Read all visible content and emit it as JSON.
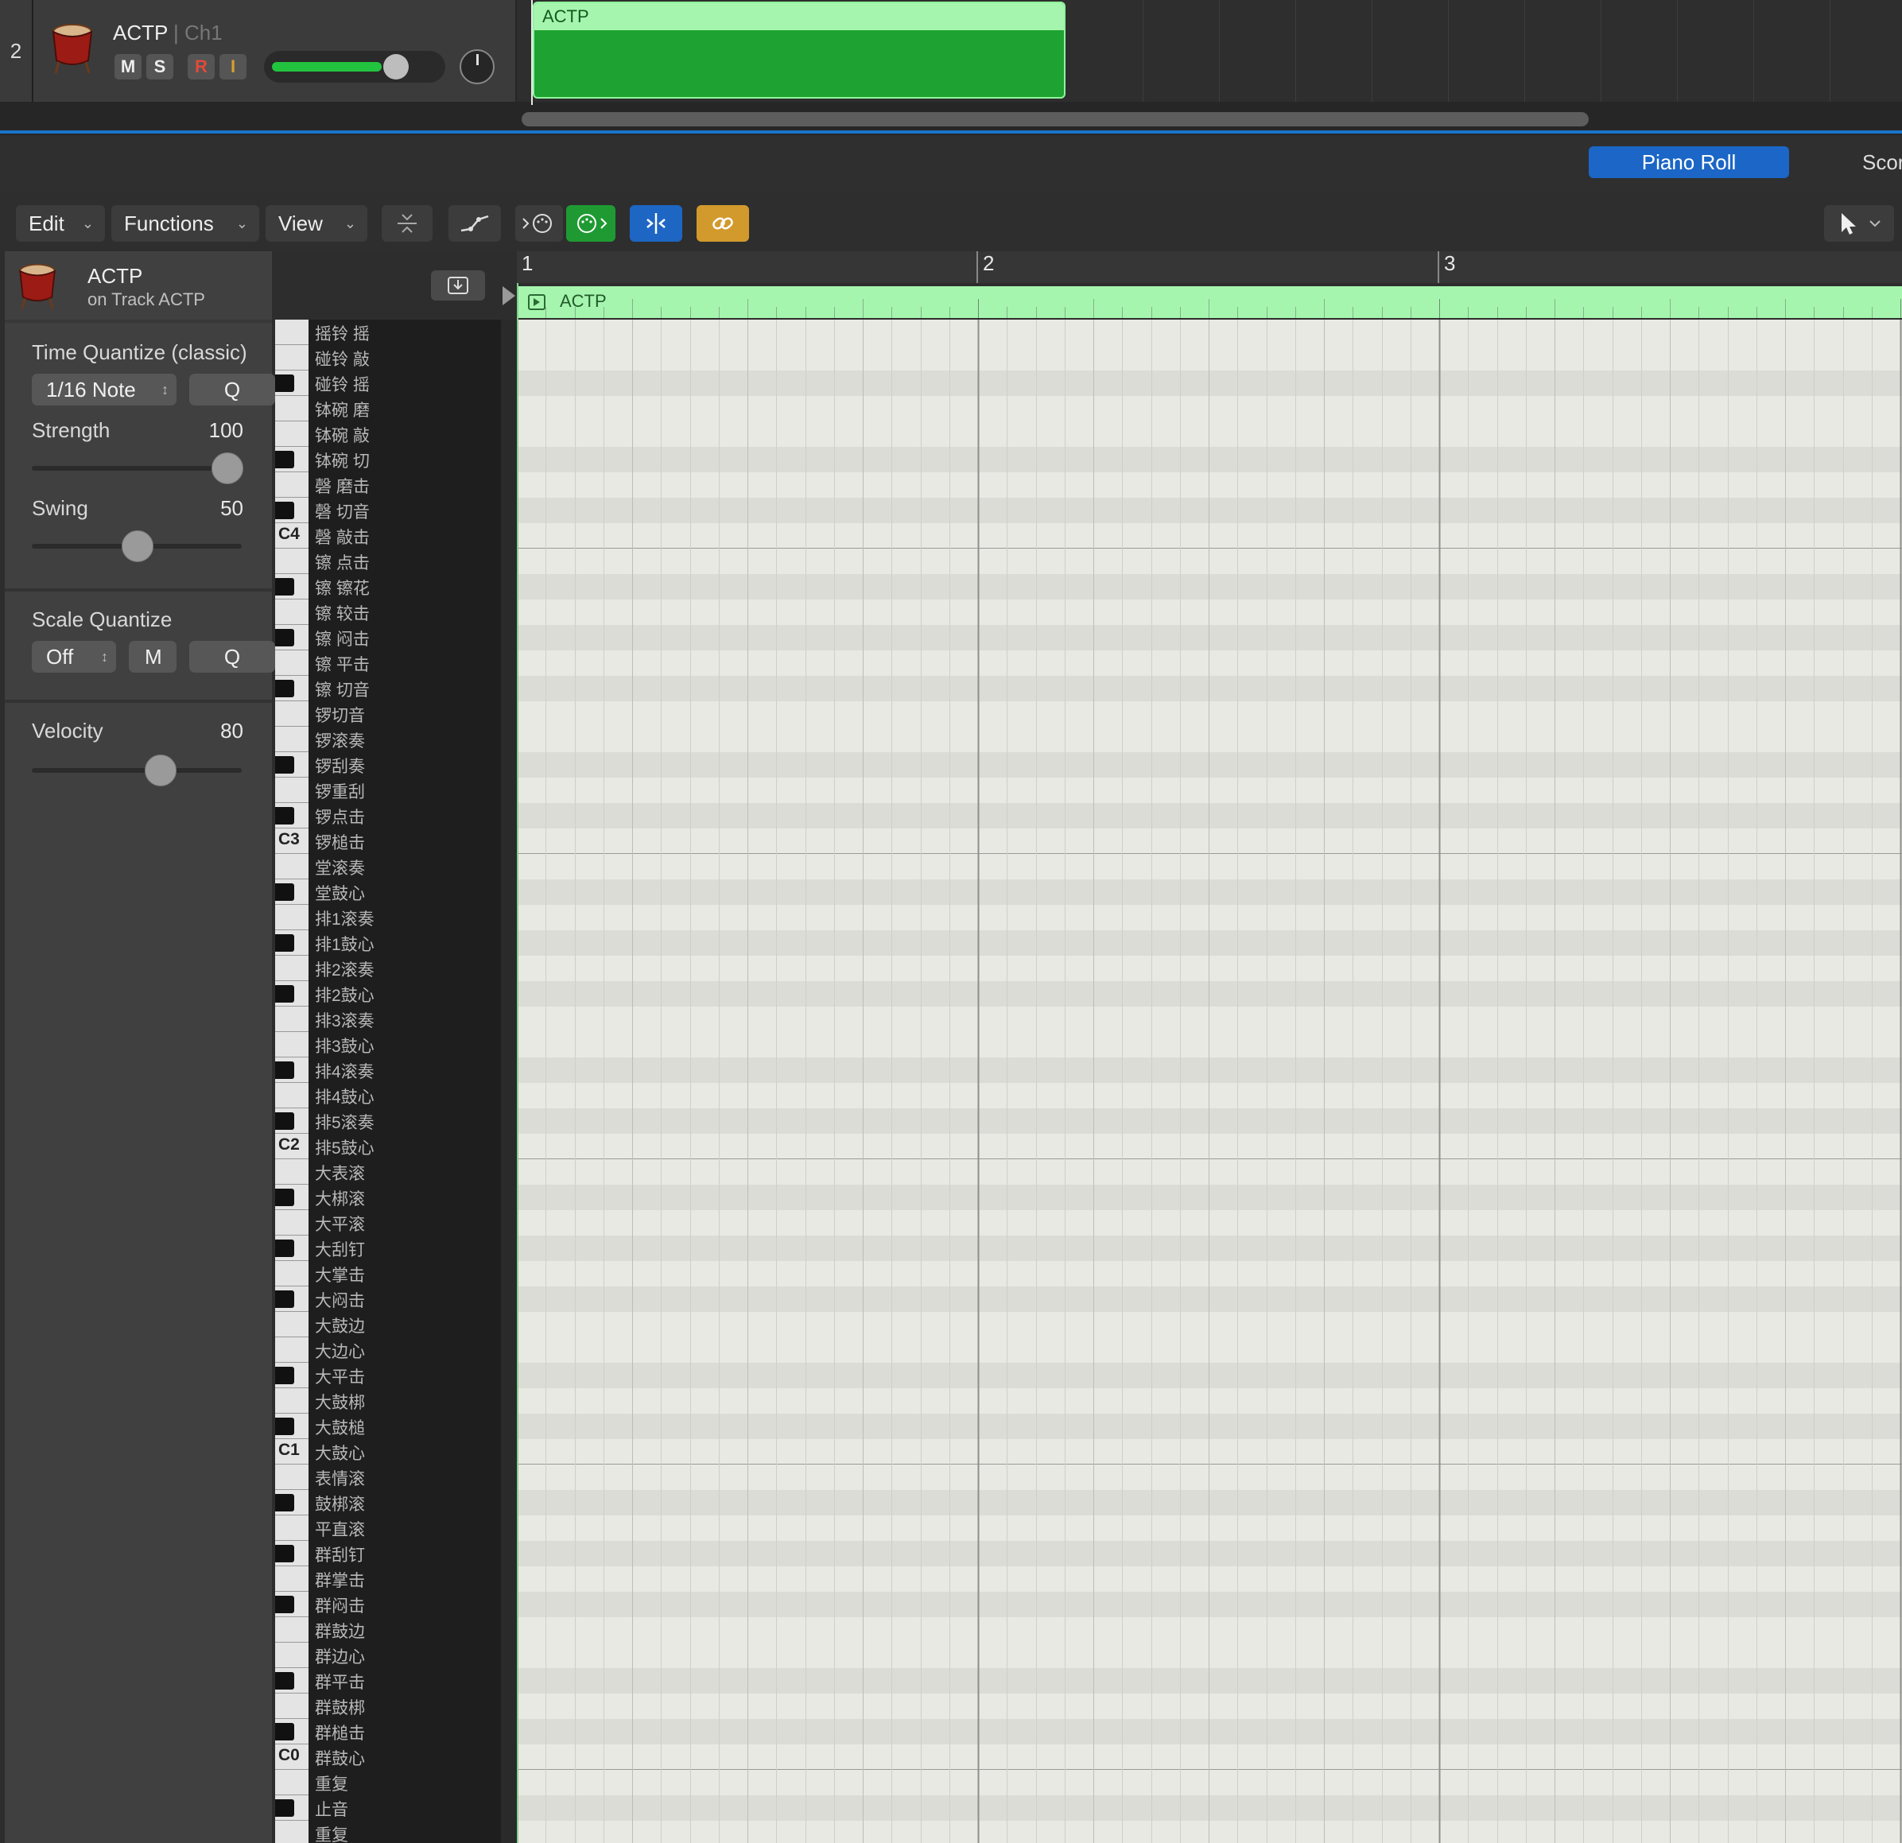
{
  "track": {
    "number": "2",
    "name": "ACTP",
    "channel": "| Ch1",
    "mute": "M",
    "solo": "S",
    "record": "R",
    "input": "I",
    "icon": "drum-icon",
    "volume_level": 0.82
  },
  "arrange_region": {
    "name": "ACTP"
  },
  "editor_tabs": {
    "active": "Piano Roll",
    "next": "Scor"
  },
  "menus": {
    "edit": "Edit",
    "functions": "Functions",
    "view": "View"
  },
  "region_header": {
    "name": "ACTP",
    "subtitle": "on Track ACTP"
  },
  "time_quantize": {
    "label": "Time Quantize (classic)",
    "value": "1/16 Note",
    "q": "Q",
    "strength_label": "Strength",
    "strength": "100",
    "strength_level": 1.0,
    "swing_label": "Swing",
    "swing": "50",
    "swing_level": 0.5
  },
  "scale_quantize": {
    "label": "Scale Quantize",
    "value": "Off",
    "mode": "M",
    "q": "Q"
  },
  "velocity": {
    "label": "Velocity",
    "value": "80",
    "level": 0.63
  },
  "ruler": {
    "bars": [
      "1",
      "2",
      "3"
    ]
  },
  "piano_region": {
    "name": "ACTP"
  },
  "keys": [
    {
      "name": "摇铃 摇",
      "black": false,
      "c": ""
    },
    {
      "name": "碰铃 敲",
      "black": false,
      "c": ""
    },
    {
      "name": "碰铃 摇",
      "black": true,
      "c": ""
    },
    {
      "name": "钵碗 磨",
      "black": false,
      "c": ""
    },
    {
      "name": "钵碗 敲",
      "black": false,
      "c": ""
    },
    {
      "name": "钵碗 切",
      "black": true,
      "c": ""
    },
    {
      "name": "磬 磨击",
      "black": false,
      "c": ""
    },
    {
      "name": "磬 切音",
      "black": true,
      "c": ""
    },
    {
      "name": "磬 敲击",
      "black": false,
      "c": "C4"
    },
    {
      "name": "镲 点击",
      "black": false,
      "c": ""
    },
    {
      "name": "镲 镲花",
      "black": true,
      "c": ""
    },
    {
      "name": "镲 较击",
      "black": false,
      "c": ""
    },
    {
      "name": "镲 闷击",
      "black": true,
      "c": ""
    },
    {
      "name": "镲 平击",
      "black": false,
      "c": ""
    },
    {
      "name": "镲 切音",
      "black": true,
      "c": ""
    },
    {
      "name": "锣切音",
      "black": false,
      "c": ""
    },
    {
      "name": "锣滚奏",
      "black": false,
      "c": ""
    },
    {
      "name": "锣刮奏",
      "black": true,
      "c": ""
    },
    {
      "name": "锣重刮",
      "black": false,
      "c": ""
    },
    {
      "name": "锣点击",
      "black": true,
      "c": ""
    },
    {
      "name": "锣槌击",
      "black": false,
      "c": "C3"
    },
    {
      "name": "堂滚奏",
      "black": false,
      "c": ""
    },
    {
      "name": "堂鼓心",
      "black": true,
      "c": ""
    },
    {
      "name": "排1滚奏",
      "black": false,
      "c": ""
    },
    {
      "name": "排1鼓心",
      "black": true,
      "c": ""
    },
    {
      "name": "排2滚奏",
      "black": false,
      "c": ""
    },
    {
      "name": "排2鼓心",
      "black": true,
      "c": ""
    },
    {
      "name": "排3滚奏",
      "black": false,
      "c": ""
    },
    {
      "name": "排3鼓心",
      "black": false,
      "c": ""
    },
    {
      "name": "排4滚奏",
      "black": true,
      "c": ""
    },
    {
      "name": "排4鼓心",
      "black": false,
      "c": ""
    },
    {
      "name": "排5滚奏",
      "black": true,
      "c": ""
    },
    {
      "name": "排5鼓心",
      "black": false,
      "c": "C2"
    },
    {
      "name": "大表滚",
      "black": false,
      "c": ""
    },
    {
      "name": "大梆滚",
      "black": true,
      "c": ""
    },
    {
      "name": "大平滚",
      "black": false,
      "c": ""
    },
    {
      "name": "大刮钉",
      "black": true,
      "c": ""
    },
    {
      "name": "大掌击",
      "black": false,
      "c": ""
    },
    {
      "name": "大闷击",
      "black": true,
      "c": ""
    },
    {
      "name": "大鼓边",
      "black": false,
      "c": ""
    },
    {
      "name": "大边心",
      "black": false,
      "c": ""
    },
    {
      "name": "大平击",
      "black": true,
      "c": ""
    },
    {
      "name": "大鼓梆",
      "black": false,
      "c": ""
    },
    {
      "name": "大鼓槌",
      "black": true,
      "c": ""
    },
    {
      "name": "大鼓心",
      "black": false,
      "c": "C1"
    },
    {
      "name": "表情滚",
      "black": false,
      "c": ""
    },
    {
      "name": "鼓梆滚",
      "black": true,
      "c": ""
    },
    {
      "name": "平直滚",
      "black": false,
      "c": ""
    },
    {
      "name": "群刮钉",
      "black": true,
      "c": ""
    },
    {
      "name": "群掌击",
      "black": false,
      "c": ""
    },
    {
      "name": "群闷击",
      "black": true,
      "c": ""
    },
    {
      "name": "群鼓边",
      "black": false,
      "c": ""
    },
    {
      "name": "群边心",
      "black": false,
      "c": ""
    },
    {
      "name": "群平击",
      "black": true,
      "c": ""
    },
    {
      "name": "群鼓梆",
      "black": false,
      "c": ""
    },
    {
      "name": "群槌击",
      "black": true,
      "c": ""
    },
    {
      "name": "群鼓心",
      "black": false,
      "c": "C0"
    },
    {
      "name": "重复",
      "black": false,
      "c": ""
    },
    {
      "name": "止音",
      "black": true,
      "c": ""
    },
    {
      "name": "重复",
      "black": false,
      "c": ""
    }
  ],
  "colors": {
    "accent": "#1a74c8",
    "region": "#1ea232",
    "region_light": "#a6f5ae",
    "link": "#d29a2c"
  }
}
